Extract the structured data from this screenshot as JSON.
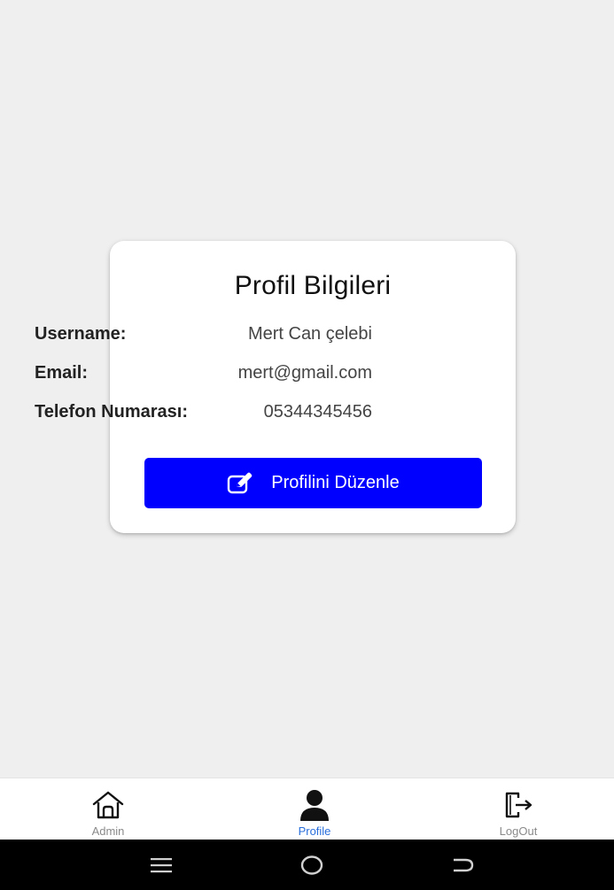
{
  "card": {
    "title": "Profil Bilgileri",
    "rows": [
      {
        "label": "Username:",
        "value": "Mert Can çelebi"
      },
      {
        "label": "Email:",
        "value": "mert@gmail.com"
      },
      {
        "label": "Telefon Numarası:",
        "value": "05344345456"
      }
    ],
    "edit_button": {
      "label": "Profilini Düzenle",
      "icon": "edit-icon"
    }
  },
  "bottom_nav": {
    "items": [
      {
        "label": "Admin",
        "icon": "home-icon",
        "active": false
      },
      {
        "label": "Profile",
        "icon": "person-icon",
        "active": true
      },
      {
        "label": "LogOut",
        "icon": "logout-icon",
        "active": false
      }
    ]
  },
  "system_nav": {
    "buttons": [
      "menu-icon",
      "home-circle-icon",
      "back-icon"
    ]
  },
  "colors": {
    "background": "#efefef",
    "card": "#ffffff",
    "primary_button": "#0000ff",
    "active_nav": "#2a6fdb",
    "inactive_nav": "#8a8a8a",
    "system_bar": "#000000"
  }
}
